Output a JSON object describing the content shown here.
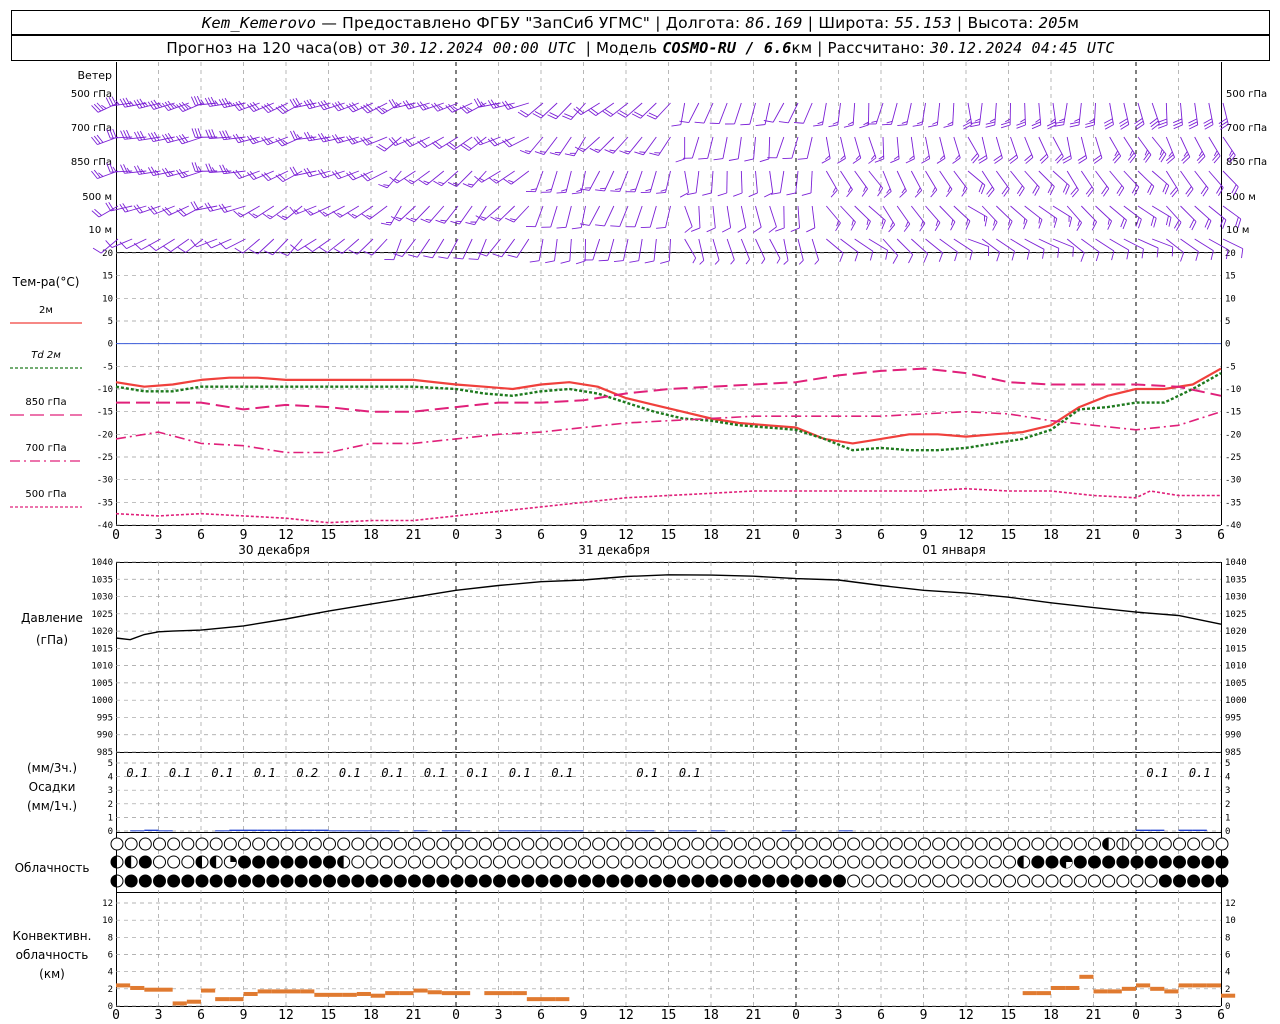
{
  "header": {
    "station": "Kem_Kemerovo",
    "provider": "— Предоставлено ФГБУ \"ЗапСиб УГМС\" |",
    "lon_label": "Долгота:",
    "lon": "86.169",
    "lat_label": "| Широта:",
    "lat": "55.153",
    "alt_label": "| Высота:",
    "alt": "205",
    "alt_unit": "м",
    "forecast_label": "Прогноз на 120 часа(ов) от",
    "forecast_start": "30.12.2024 00:00 UTC",
    "model_label": "| Модель",
    "model": "COSMO-RU / 6.6",
    "model_unit": "км",
    "calc_label": "| Рассчитано:",
    "calc_time": "30.12.2024 04:45 UTC"
  },
  "wind_panel": {
    "title": "Ветер",
    "levels": [
      "500 гПа",
      "700 гПа",
      "850 гПа",
      "500 м",
      "10 м"
    ]
  },
  "temp_panel": {
    "title": "Тем-ра(°С)",
    "legend": [
      {
        "label": "2м",
        "color": "#f0403c",
        "dash": ""
      },
      {
        "label": "Td 2м",
        "color": "#1e7a1e",
        "dash": "3,2"
      },
      {
        "label": "850 гПа",
        "color": "#e0207a",
        "dash": "14,6"
      },
      {
        "label": "700 гПа",
        "color": "#e0207a",
        "dash": "10,4,2,4"
      },
      {
        "label": "500 гПа",
        "color": "#e0207a",
        "dash": "3,2"
      }
    ],
    "y_ticks": [
      "20",
      "15",
      "10",
      "5",
      "0",
      "-5",
      "-10",
      "-15",
      "-20",
      "-25",
      "-30",
      "-35",
      "-40"
    ]
  },
  "time_axis": {
    "hour_labels": [
      "0",
      "3",
      "6",
      "9",
      "12",
      "15",
      "18",
      "21",
      "0",
      "3",
      "6",
      "9",
      "12",
      "15",
      "18",
      "21",
      "0",
      "3",
      "6",
      "9",
      "12",
      "15",
      "18",
      "21",
      "0",
      "3",
      "6"
    ],
    "dates": [
      "30 декабря",
      "31 декабря",
      "01 января"
    ]
  },
  "pressure_panel": {
    "title": "Давление",
    "unit": "(гПа)",
    "y_ticks": [
      "1040",
      "1035",
      "1030",
      "1025",
      "1020",
      "1015",
      "1010",
      "1005",
      "1000",
      "995",
      "990",
      "985"
    ]
  },
  "precip_panel": {
    "title1": "(мм/3ч.)",
    "title2": "Осадки",
    "title3": "(мм/1ч.)",
    "y_ticks": [
      "5",
      "4",
      "3",
      "2",
      "1",
      "0"
    ],
    "labels": [
      {
        "hour": 3,
        "text": "0.1"
      },
      {
        "hour": 6,
        "text": "0.1"
      },
      {
        "hour": 9,
        "text": "0.1"
      },
      {
        "hour": 12,
        "text": "0.1"
      },
      {
        "hour": 15,
        "text": "0.2"
      },
      {
        "hour": 18,
        "text": "0.1"
      },
      {
        "hour": 21,
        "text": "0.1"
      },
      {
        "hour": 24,
        "text": "0.1"
      },
      {
        "hour": 27,
        "text": "0.1"
      },
      {
        "hour": 30,
        "text": "0.1"
      },
      {
        "hour": 33,
        "text": "0.1"
      },
      {
        "hour": 39,
        "text": "0.1"
      },
      {
        "hour": 42,
        "text": "0.1"
      },
      {
        "hour": 75,
        "text": "0.1"
      },
      {
        "hour": 78,
        "text": "0.1"
      }
    ]
  },
  "cloud_panel": {
    "title": "Облачность"
  },
  "conv_panel": {
    "title1": "Конвективн.",
    "title2": "облачность",
    "title3": "(км)",
    "y_ticks": [
      "12",
      "10",
      "8",
      "6",
      "4",
      "2",
      "0"
    ]
  },
  "chart_data": [
    {
      "type": "line",
      "title": "Тем-ра(°С)",
      "x_unit": "hours from 30.12.2024 00:00 UTC",
      "ylim": [
        -40,
        20
      ],
      "series": [
        {
          "name": "2м",
          "x": [
            0,
            2,
            4,
            6,
            8,
            10,
            12,
            15,
            18,
            21,
            24,
            26,
            28,
            30,
            32,
            34,
            36,
            38,
            40,
            42,
            44,
            46,
            48,
            50,
            52,
            54,
            56,
            58,
            60,
            62,
            64,
            66,
            68,
            70,
            72,
            74,
            76,
            78
          ],
          "values": [
            -8.5,
            -9.5,
            -9,
            -8,
            -7.5,
            -7.5,
            -8,
            -8,
            -8,
            -8,
            -9,
            -9.5,
            -10,
            -9,
            -8.5,
            -9.5,
            -12,
            -13.5,
            -15,
            -16.5,
            -17.5,
            -18,
            -18.5,
            -21,
            -22,
            -21,
            -20,
            -20,
            -20.5,
            -20,
            -19.5,
            -18,
            -14,
            -11.5,
            -10,
            -10,
            -9,
            -5.5
          ]
        },
        {
          "name": "Td 2м",
          "x": [
            0,
            2,
            4,
            6,
            8,
            10,
            12,
            15,
            18,
            21,
            24,
            26,
            28,
            30,
            32,
            34,
            36,
            38,
            40,
            42,
            44,
            46,
            48,
            50,
            52,
            54,
            56,
            58,
            60,
            62,
            64,
            66,
            68,
            70,
            72,
            74,
            76,
            78
          ],
          "values": [
            -9.5,
            -10.5,
            -10.5,
            -9.5,
            -9.5,
            -9.5,
            -9.5,
            -9.5,
            -9.5,
            -9.5,
            -10,
            -11,
            -11.5,
            -10.5,
            -10,
            -11,
            -13,
            -15,
            -16.5,
            -17,
            -18,
            -18.5,
            -19,
            -21,
            -23.5,
            -23,
            -23.5,
            -23.5,
            -23,
            -22,
            -21,
            -19,
            -14.5,
            -14,
            -13,
            -13,
            -10,
            -6.5
          ]
        },
        {
          "name": "850 гПа",
          "x": [
            0,
            3,
            6,
            9,
            12,
            15,
            18,
            21,
            24,
            27,
            30,
            33,
            36,
            39,
            42,
            45,
            48,
            51,
            54,
            57,
            60,
            63,
            66,
            69,
            72,
            75,
            78
          ],
          "values": [
            -13,
            -13,
            -13,
            -14.5,
            -13.5,
            -14,
            -15,
            -15,
            -14,
            -13,
            -13,
            -12.5,
            -11,
            -10,
            -9.5,
            -9,
            -8.5,
            -7,
            -6,
            -5.5,
            -6.5,
            -8.5,
            -9,
            -9,
            -9,
            -9.5,
            -11.5
          ]
        },
        {
          "name": "700 гПа",
          "x": [
            0,
            3,
            6,
            9,
            12,
            15,
            18,
            21,
            24,
            27,
            30,
            33,
            36,
            39,
            42,
            45,
            48,
            51,
            54,
            57,
            60,
            63,
            66,
            69,
            72,
            75,
            78
          ],
          "values": [
            -21,
            -19.5,
            -22,
            -22.5,
            -24,
            -24,
            -22,
            -22,
            -21,
            -20,
            -19.5,
            -18.5,
            -17.5,
            -17,
            -16.5,
            -16,
            -16,
            -16,
            -16,
            -15.5,
            -15,
            -15.5,
            -17,
            -18,
            -19,
            -18,
            -15
          ]
        },
        {
          "name": "500 гПа",
          "x": [
            0,
            3,
            6,
            9,
            12,
            15,
            18,
            21,
            24,
            27,
            30,
            33,
            36,
            39,
            42,
            45,
            48,
            51,
            54,
            57,
            60,
            63,
            66,
            69,
            72,
            73,
            75,
            78
          ],
          "values": [
            -37.5,
            -38,
            -37.5,
            -38,
            -38.5,
            -39.5,
            -39,
            -39,
            -38,
            -37,
            -36,
            -35,
            -34,
            -33.5,
            -33,
            -32.5,
            -32.5,
            -32.5,
            -32.5,
            -32.5,
            -32,
            -32.5,
            -32.5,
            -33.5,
            -34,
            -32.5,
            -33.5,
            -33.5
          ]
        }
      ]
    },
    {
      "type": "line",
      "title": "Давление",
      "x_unit": "hours from 30.12.2024 00:00 UTC",
      "ylim": [
        985,
        1040
      ],
      "series": [
        {
          "name": "Давление",
          "x": [
            0,
            1,
            2,
            3,
            4,
            6,
            9,
            12,
            15,
            18,
            21,
            24,
            27,
            30,
            33,
            36,
            39,
            42,
            45,
            48,
            51,
            54,
            57,
            60,
            63,
            66,
            69,
            72,
            75,
            78
          ],
          "values": [
            1018,
            1017.5,
            1019,
            1019.8,
            1020,
            1020.3,
            1021.5,
            1023.5,
            1025.8,
            1027.8,
            1029.8,
            1031.8,
            1033.2,
            1034.3,
            1034.8,
            1035.8,
            1036.3,
            1036.2,
            1035.9,
            1035.2,
            1034.8,
            1033.2,
            1031.8,
            1031,
            1029.8,
            1028.2,
            1026.8,
            1025.5,
            1024.5,
            1022
          ]
        }
      ]
    },
    {
      "type": "bar",
      "title": "Осадки",
      "x_unit": "hours from 30.12.2024 00:00 UTC",
      "ylim": [
        0,
        5
      ],
      "x": [
        2,
        3,
        4,
        8,
        9,
        10,
        11,
        12,
        13,
        14,
        15,
        16,
        17,
        18,
        19,
        20,
        22,
        24,
        25,
        28,
        29,
        30,
        31,
        32,
        33,
        37,
        38,
        40,
        41,
        43,
        48,
        52,
        73,
        74,
        76,
        77
      ],
      "values": [
        0.05,
        0.1,
        0.05,
        0.05,
        0.1,
        0.1,
        0.1,
        0.1,
        0.1,
        0.1,
        0.1,
        0.05,
        0.05,
        0.05,
        0.05,
        0.05,
        0.05,
        0.05,
        0.05,
        0.05,
        0.05,
        0.05,
        0.05,
        0.05,
        0.05,
        0.05,
        0.05,
        0.05,
        0.05,
        0.05,
        0.05,
        0.05,
        0.1,
        0.1,
        0.1,
        0.1
      ]
    },
    {
      "type": "bar",
      "title": "Конвективн. облачность",
      "x_unit": "hours from 30.12.2024 00:00 UTC",
      "ylim": [
        0,
        12
      ],
      "x": [
        0,
        1,
        2,
        3,
        4,
        5,
        6,
        7,
        8,
        9,
        10,
        11,
        12,
        13,
        14,
        15,
        16,
        17,
        18,
        19,
        20,
        21,
        22,
        23,
        24,
        25,
        26,
        27,
        28,
        29,
        30,
        31,
        32,
        33,
        64,
        65,
        66,
        67,
        68,
        69,
        70,
        71,
        72,
        73,
        74,
        75,
        76,
        77,
        78
      ],
      "values": [
        2.4,
        2.1,
        1.9,
        1.9,
        0.3,
        0.5,
        1.8,
        0.8,
        0.8,
        1.4,
        1.7,
        1.7,
        1.7,
        1.7,
        1.3,
        1.3,
        1.3,
        1.4,
        1.2,
        1.5,
        1.5,
        1.8,
        1.6,
        1.5,
        1.5,
        0.0,
        1.5,
        1.5,
        1.5,
        0.8,
        0.8,
        0.8,
        0.0,
        0.0,
        1.5,
        1.5,
        2.1,
        2.1,
        3.4,
        1.7,
        1.7,
        2.0,
        2.4,
        2.0,
        1.7,
        2.4,
        2.4,
        2.4,
        1.2
      ]
    }
  ],
  "cloud_rows": {
    "low": "OOOOOOOOOOOOOOOOOOOOOOOOOOOOOOOOOOOOOOOOOOOOOOOOOOOOOOOOOOOOOOOOOOOOOOOOOOOOOOOOOOOOOOOOOOOOOOOOOOOOOOOOOOOOOOOOOOOOOOOOOOOOOOOOOOOOO",
    "mid": "T",
    "high": "F"
  },
  "colors": {
    "wind": "#7b1fd6",
    "grid": "#9a9a9a",
    "zero": "#3a5bd9",
    "precip": "#2040d0",
    "conv": "#e07a30"
  }
}
